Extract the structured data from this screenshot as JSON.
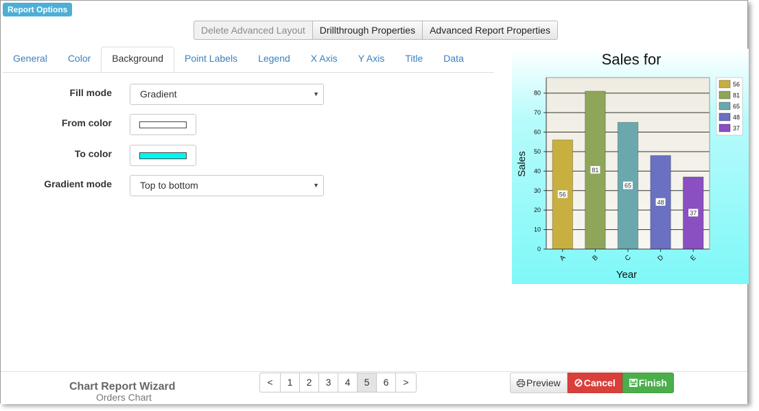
{
  "header": {
    "report_options": "Report Options"
  },
  "top_buttons": {
    "delete_layout": "Delete Advanced Layout",
    "drillthrough": "Drillthrough Properties",
    "advanced": "Advanced Report Properties"
  },
  "tabs": [
    {
      "label": "General"
    },
    {
      "label": "Color"
    },
    {
      "label": "Background"
    },
    {
      "label": "Point Labels"
    },
    {
      "label": "Legend"
    },
    {
      "label": "X Axis"
    },
    {
      "label": "Y Axis"
    },
    {
      "label": "Title"
    },
    {
      "label": "Data"
    }
  ],
  "active_tab": "Background",
  "form": {
    "fill_mode": {
      "label": "Fill mode",
      "value": "Gradient"
    },
    "from_color": {
      "label": "From color",
      "value": "#ffffff"
    },
    "to_color": {
      "label": "To color",
      "value": "#00f5f0"
    },
    "gradient_mode": {
      "label": "Gradient mode",
      "value": "Top to bottom"
    }
  },
  "chart_data": {
    "type": "bar",
    "title": "Sales for",
    "xlabel": "Year",
    "ylabel": "Sales",
    "categories": [
      "A",
      "B",
      "C",
      "D",
      "E"
    ],
    "values": [
      56,
      81,
      65,
      48,
      37
    ],
    "ylim": [
      0,
      88
    ],
    "yticks": [
      0,
      10,
      20,
      30,
      40,
      50,
      60,
      70,
      80
    ],
    "colors": [
      "#c8b040",
      "#8fa65a",
      "#6aa8ad",
      "#6a70c2",
      "#8a4fc0"
    ],
    "legend": [
      "56",
      "81",
      "65",
      "48",
      "37"
    ],
    "legend_position": "right",
    "grid": true
  },
  "footer": {
    "wizard_title": "Chart Report Wizard",
    "wizard_subtitle": "Orders Chart",
    "pages": [
      "<",
      "1",
      "2",
      "3",
      "4",
      "5",
      "6",
      ">"
    ],
    "active_page": "5",
    "preview": "Preview",
    "cancel": "Cancel",
    "finish": "Finish"
  }
}
